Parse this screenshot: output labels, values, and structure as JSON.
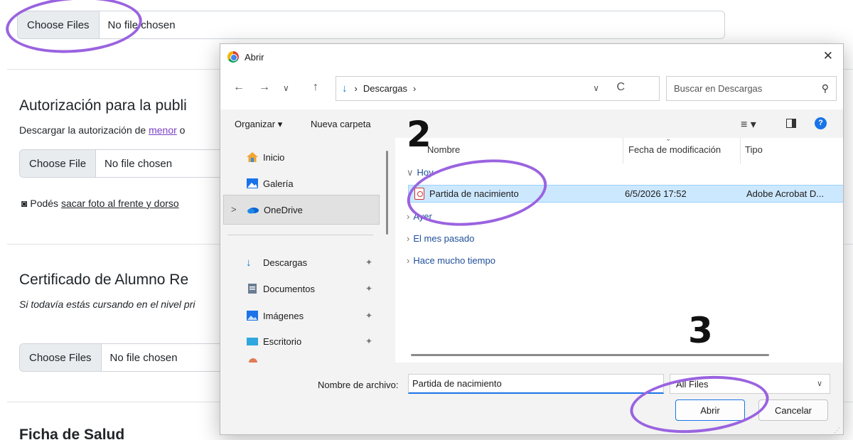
{
  "form": {
    "file_inputs": [
      {
        "button": "Choose Files",
        "text": "No file chosen"
      },
      {
        "button": "Choose File",
        "text": "No file chosen"
      },
      {
        "button": "Choose Files",
        "text": "No file chosen"
      }
    ],
    "sections": {
      "autorizacion": {
        "title": "Autorización para la publi",
        "desc_prefix": "Descargar la autorización de ",
        "desc_link": "menor",
        "desc_suffix": " o",
        "photo_prefix": "Podés ",
        "photo_link": "sacar foto al frente y dorso"
      },
      "certificado": {
        "title": "Certificado de Alumno Re",
        "desc": "Si todavía estás cursando en el nivel pri"
      },
      "salud": {
        "title": "Ficha de Salud"
      }
    }
  },
  "annotations": {
    "step2": "2",
    "step3": "3"
  },
  "dialog": {
    "title": "Abrir",
    "close_glyph": "✕",
    "nav": {
      "back": "←",
      "forward": "→",
      "recent": "∨",
      "up": "↑"
    },
    "address": {
      "download_glyph": "↓",
      "sep": "›",
      "location": "Descargas",
      "sep2": "›",
      "chevron": "∨",
      "refresh": "C"
    },
    "search": {
      "placeholder": "Buscar en Descargas",
      "glyph": "⚲"
    },
    "toolbar": {
      "organize": "Organizar ▾",
      "new_folder": "Nueva carpeta",
      "view_glyph": "≡ ▾",
      "help": "?"
    },
    "nav_pane": [
      {
        "label": "Inicio",
        "icon": "home-icon",
        "color": "#f2a533"
      },
      {
        "label": "Galería",
        "icon": "gallery-icon",
        "color": "#1a73e8"
      },
      {
        "label": "OneDrive",
        "icon": "onedrive-icon",
        "color": "#0a64d6",
        "expand": ">"
      },
      {
        "label": "Descargas",
        "icon": "download-icon",
        "color": "#0a7bd4",
        "pin": "📌"
      },
      {
        "label": "Documentos",
        "icon": "documents-icon",
        "color": "#6b7c93",
        "pin": "📌"
      },
      {
        "label": "Imágenes",
        "icon": "pictures-icon",
        "color": "#1a73e8",
        "pin": "📌"
      },
      {
        "label": "Escritorio",
        "icon": "desktop-icon",
        "color": "#2fa6e0",
        "pin": "📌"
      }
    ],
    "columns": {
      "name": "Nombre",
      "modified": "Fecha de modificación",
      "type": "Tipo"
    },
    "groups": {
      "today": "Hoy",
      "yesterday": "Ayer",
      "last_month": "El mes pasado",
      "long_ago": "Hace mucho tiempo"
    },
    "files": [
      {
        "name": "Partida de nacimiento",
        "modified": "6/5/2026 17:52",
        "type": "Adobe Acrobat D..."
      }
    ],
    "bottom": {
      "filename_label": "Nombre de archivo:",
      "filename_value": "Partida de nacimiento",
      "filter": "All Files",
      "open": "Abrir",
      "cancel": "Cancelar"
    }
  },
  "colors": {
    "annotation": "#9a63e0",
    "selection": "#cce8ff",
    "accent": "#1a73e8",
    "link": "#7b3fc4"
  }
}
